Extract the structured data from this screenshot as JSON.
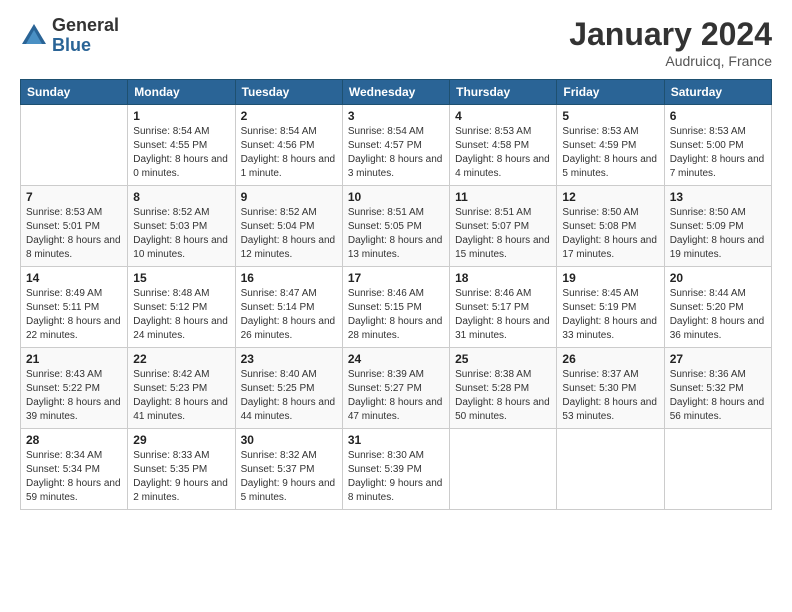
{
  "header": {
    "logo_general": "General",
    "logo_blue": "Blue",
    "month_title": "January 2024",
    "location": "Audruicq, France"
  },
  "weekdays": [
    "Sunday",
    "Monday",
    "Tuesday",
    "Wednesday",
    "Thursday",
    "Friday",
    "Saturday"
  ],
  "weeks": [
    [
      {
        "day": "",
        "sunrise": "",
        "sunset": "",
        "daylight": ""
      },
      {
        "day": "1",
        "sunrise": "Sunrise: 8:54 AM",
        "sunset": "Sunset: 4:55 PM",
        "daylight": "Daylight: 8 hours and 0 minutes."
      },
      {
        "day": "2",
        "sunrise": "Sunrise: 8:54 AM",
        "sunset": "Sunset: 4:56 PM",
        "daylight": "Daylight: 8 hours and 1 minute."
      },
      {
        "day": "3",
        "sunrise": "Sunrise: 8:54 AM",
        "sunset": "Sunset: 4:57 PM",
        "daylight": "Daylight: 8 hours and 3 minutes."
      },
      {
        "day": "4",
        "sunrise": "Sunrise: 8:53 AM",
        "sunset": "Sunset: 4:58 PM",
        "daylight": "Daylight: 8 hours and 4 minutes."
      },
      {
        "day": "5",
        "sunrise": "Sunrise: 8:53 AM",
        "sunset": "Sunset: 4:59 PM",
        "daylight": "Daylight: 8 hours and 5 minutes."
      },
      {
        "day": "6",
        "sunrise": "Sunrise: 8:53 AM",
        "sunset": "Sunset: 5:00 PM",
        "daylight": "Daylight: 8 hours and 7 minutes."
      }
    ],
    [
      {
        "day": "7",
        "sunrise": "Sunrise: 8:53 AM",
        "sunset": "Sunset: 5:01 PM",
        "daylight": "Daylight: 8 hours and 8 minutes."
      },
      {
        "day": "8",
        "sunrise": "Sunrise: 8:52 AM",
        "sunset": "Sunset: 5:03 PM",
        "daylight": "Daylight: 8 hours and 10 minutes."
      },
      {
        "day": "9",
        "sunrise": "Sunrise: 8:52 AM",
        "sunset": "Sunset: 5:04 PM",
        "daylight": "Daylight: 8 hours and 12 minutes."
      },
      {
        "day": "10",
        "sunrise": "Sunrise: 8:51 AM",
        "sunset": "Sunset: 5:05 PM",
        "daylight": "Daylight: 8 hours and 13 minutes."
      },
      {
        "day": "11",
        "sunrise": "Sunrise: 8:51 AM",
        "sunset": "Sunset: 5:07 PM",
        "daylight": "Daylight: 8 hours and 15 minutes."
      },
      {
        "day": "12",
        "sunrise": "Sunrise: 8:50 AM",
        "sunset": "Sunset: 5:08 PM",
        "daylight": "Daylight: 8 hours and 17 minutes."
      },
      {
        "day": "13",
        "sunrise": "Sunrise: 8:50 AM",
        "sunset": "Sunset: 5:09 PM",
        "daylight": "Daylight: 8 hours and 19 minutes."
      }
    ],
    [
      {
        "day": "14",
        "sunrise": "Sunrise: 8:49 AM",
        "sunset": "Sunset: 5:11 PM",
        "daylight": "Daylight: 8 hours and 22 minutes."
      },
      {
        "day": "15",
        "sunrise": "Sunrise: 8:48 AM",
        "sunset": "Sunset: 5:12 PM",
        "daylight": "Daylight: 8 hours and 24 minutes."
      },
      {
        "day": "16",
        "sunrise": "Sunrise: 8:47 AM",
        "sunset": "Sunset: 5:14 PM",
        "daylight": "Daylight: 8 hours and 26 minutes."
      },
      {
        "day": "17",
        "sunrise": "Sunrise: 8:46 AM",
        "sunset": "Sunset: 5:15 PM",
        "daylight": "Daylight: 8 hours and 28 minutes."
      },
      {
        "day": "18",
        "sunrise": "Sunrise: 8:46 AM",
        "sunset": "Sunset: 5:17 PM",
        "daylight": "Daylight: 8 hours and 31 minutes."
      },
      {
        "day": "19",
        "sunrise": "Sunrise: 8:45 AM",
        "sunset": "Sunset: 5:19 PM",
        "daylight": "Daylight: 8 hours and 33 minutes."
      },
      {
        "day": "20",
        "sunrise": "Sunrise: 8:44 AM",
        "sunset": "Sunset: 5:20 PM",
        "daylight": "Daylight: 8 hours and 36 minutes."
      }
    ],
    [
      {
        "day": "21",
        "sunrise": "Sunrise: 8:43 AM",
        "sunset": "Sunset: 5:22 PM",
        "daylight": "Daylight: 8 hours and 39 minutes."
      },
      {
        "day": "22",
        "sunrise": "Sunrise: 8:42 AM",
        "sunset": "Sunset: 5:23 PM",
        "daylight": "Daylight: 8 hours and 41 minutes."
      },
      {
        "day": "23",
        "sunrise": "Sunrise: 8:40 AM",
        "sunset": "Sunset: 5:25 PM",
        "daylight": "Daylight: 8 hours and 44 minutes."
      },
      {
        "day": "24",
        "sunrise": "Sunrise: 8:39 AM",
        "sunset": "Sunset: 5:27 PM",
        "daylight": "Daylight: 8 hours and 47 minutes."
      },
      {
        "day": "25",
        "sunrise": "Sunrise: 8:38 AM",
        "sunset": "Sunset: 5:28 PM",
        "daylight": "Daylight: 8 hours and 50 minutes."
      },
      {
        "day": "26",
        "sunrise": "Sunrise: 8:37 AM",
        "sunset": "Sunset: 5:30 PM",
        "daylight": "Daylight: 8 hours and 53 minutes."
      },
      {
        "day": "27",
        "sunrise": "Sunrise: 8:36 AM",
        "sunset": "Sunset: 5:32 PM",
        "daylight": "Daylight: 8 hours and 56 minutes."
      }
    ],
    [
      {
        "day": "28",
        "sunrise": "Sunrise: 8:34 AM",
        "sunset": "Sunset: 5:34 PM",
        "daylight": "Daylight: 8 hours and 59 minutes."
      },
      {
        "day": "29",
        "sunrise": "Sunrise: 8:33 AM",
        "sunset": "Sunset: 5:35 PM",
        "daylight": "Daylight: 9 hours and 2 minutes."
      },
      {
        "day": "30",
        "sunrise": "Sunrise: 8:32 AM",
        "sunset": "Sunset: 5:37 PM",
        "daylight": "Daylight: 9 hours and 5 minutes."
      },
      {
        "day": "31",
        "sunrise": "Sunrise: 8:30 AM",
        "sunset": "Sunset: 5:39 PM",
        "daylight": "Daylight: 9 hours and 8 minutes."
      },
      {
        "day": "",
        "sunrise": "",
        "sunset": "",
        "daylight": ""
      },
      {
        "day": "",
        "sunrise": "",
        "sunset": "",
        "daylight": ""
      },
      {
        "day": "",
        "sunrise": "",
        "sunset": "",
        "daylight": ""
      }
    ]
  ]
}
